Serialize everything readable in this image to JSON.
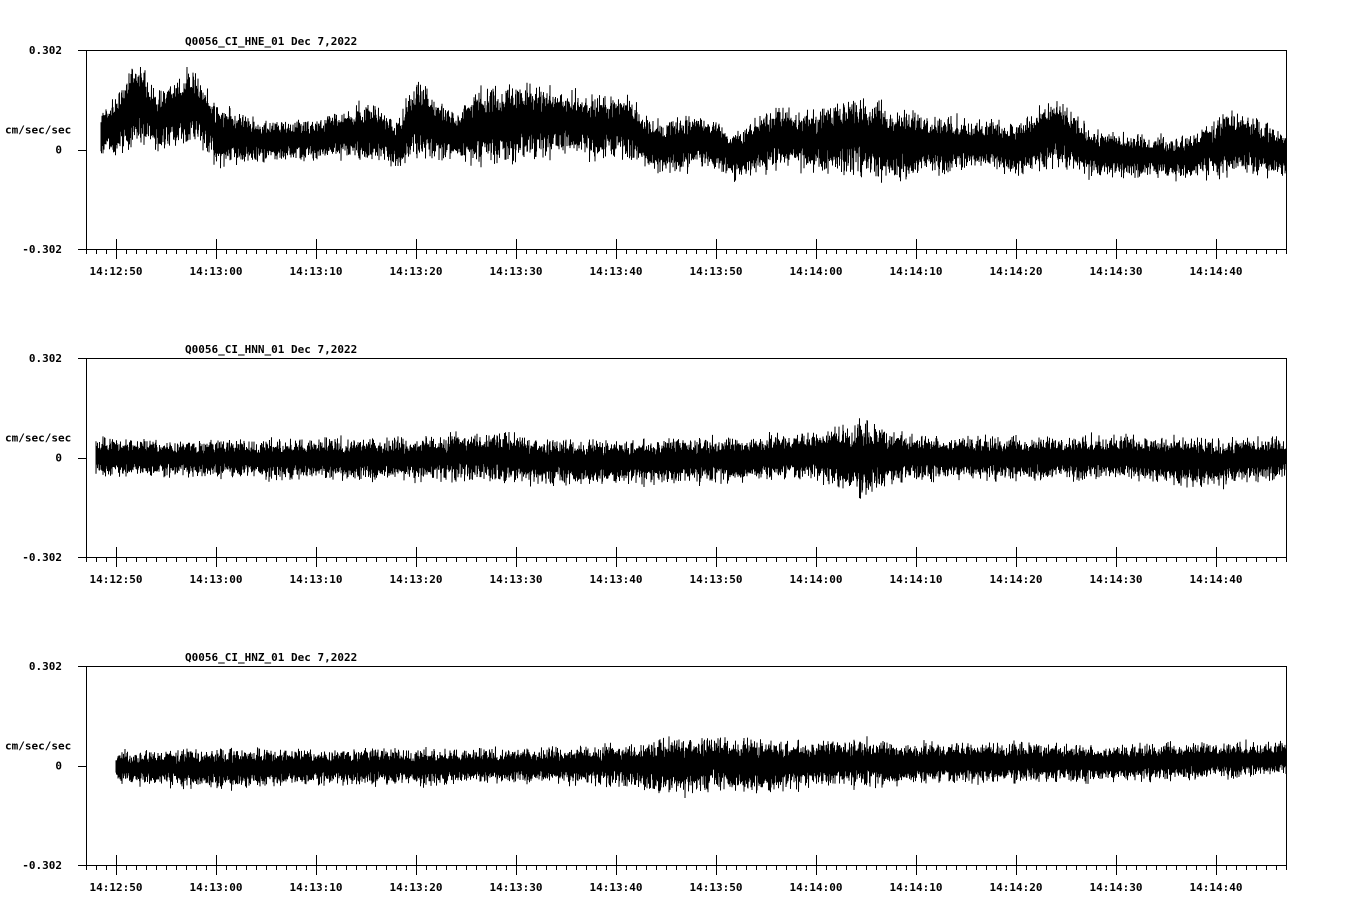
{
  "y_unit": "cm/sec/sec",
  "x_tick_labels": [
    "14:12:50",
    "14:13:00",
    "14:13:10",
    "14:13:20",
    "14:13:30",
    "14:13:40",
    "14:13:50",
    "14:14:00",
    "14:14:10",
    "14:14:20",
    "14:14:30",
    "14:14:40"
  ],
  "panels": [
    {
      "title": "Q0056_CI_HNE_01  Dec 7,2022",
      "ymax_label": "0.302",
      "zero_label": "0",
      "ymin_label": "-0.302"
    },
    {
      "title": "Q0056_CI_HNN_01  Dec 7,2022",
      "ymax_label": "0.302",
      "zero_label": "0",
      "ymin_label": "-0.302"
    },
    {
      "title": "Q0056_CI_HNZ_01  Dec 7,2022",
      "ymax_label": "0.302",
      "zero_label": "0",
      "ymin_label": "-0.302"
    }
  ],
  "chart_data": [
    {
      "type": "line",
      "title": "Q0056_CI_HNE_01  Dec 7,2022",
      "ylabel": "cm/sec/sec",
      "ylim": [
        -0.302,
        0.302
      ],
      "xlim": [
        "14:12:47",
        "14:14:47"
      ],
      "x_ticks": [
        "14:12:50",
        "14:13:00",
        "14:13:10",
        "14:13:20",
        "14:13:30",
        "14:13:40",
        "14:13:50",
        "14:14:00",
        "14:14:10",
        "14:14:20",
        "14:14:30",
        "14:14:40"
      ],
      "series_start": "14:12:48.5",
      "envelope": {
        "x": [
          "14:12:48.5",
          "14:12:50",
          "14:12:52",
          "14:12:54",
          "14:12:56",
          "14:12:58",
          "14:13:00",
          "14:13:05",
          "14:13:10",
          "14:13:14",
          "14:13:16",
          "14:13:18",
          "14:13:20",
          "14:13:24",
          "14:13:26",
          "14:13:30",
          "14:13:34",
          "14:13:38",
          "14:13:41",
          "14:13:44",
          "14:13:49",
          "14:13:52",
          "14:13:56",
          "14:14:00",
          "14:14:04",
          "14:14:07",
          "14:14:12",
          "14:14:17",
          "14:14:20",
          "14:14:24",
          "14:14:28",
          "14:14:33",
          "14:14:37",
          "14:14:42",
          "14:14:47"
        ],
        "max": [
          0.12,
          0.18,
          0.3,
          0.2,
          0.22,
          0.28,
          0.15,
          0.1,
          0.1,
          0.15,
          0.15,
          0.1,
          0.23,
          0.12,
          0.2,
          0.22,
          0.2,
          0.18,
          0.18,
          0.1,
          0.12,
          0.06,
          0.15,
          0.13,
          0.18,
          0.15,
          0.12,
          0.1,
          0.1,
          0.17,
          0.07,
          0.05,
          0.05,
          0.14,
          0.06
        ],
        "min": [
          -0.03,
          -0.03,
          -0.01,
          -0.02,
          0.0,
          0.0,
          -0.06,
          -0.05,
          -0.04,
          -0.04,
          -0.05,
          -0.07,
          -0.05,
          -0.04,
          -0.07,
          -0.05,
          -0.03,
          -0.04,
          -0.04,
          -0.09,
          -0.07,
          -0.1,
          -0.08,
          -0.08,
          -0.09,
          -0.12,
          -0.09,
          -0.07,
          -0.1,
          -0.06,
          -0.1,
          -0.09,
          -0.1,
          -0.09,
          -0.09
        ]
      }
    },
    {
      "type": "line",
      "title": "Q0056_CI_HNN_01  Dec 7,2022",
      "ylabel": "cm/sec/sec",
      "ylim": [
        -0.302,
        0.302
      ],
      "xlim": [
        "14:12:47",
        "14:14:47"
      ],
      "x_ticks": [
        "14:12:50",
        "14:13:00",
        "14:13:10",
        "14:13:20",
        "14:13:30",
        "14:13:40",
        "14:13:50",
        "14:14:00",
        "14:14:10",
        "14:14:20",
        "14:14:30",
        "14:14:40"
      ],
      "series_start": "14:12:48",
      "envelope": {
        "x": [
          "14:12:48",
          "14:13:00",
          "14:13:10",
          "14:13:20",
          "14:13:28",
          "14:13:32",
          "14:13:40",
          "14:13:50",
          "14:14:00",
          "14:14:03",
          "14:14:05",
          "14:14:07",
          "14:14:10",
          "14:14:20",
          "14:14:30",
          "14:14:40",
          "14:14:47"
        ],
        "max": [
          0.07,
          0.06,
          0.07,
          0.07,
          0.09,
          0.07,
          0.06,
          0.07,
          0.09,
          0.12,
          0.13,
          0.1,
          0.08,
          0.07,
          0.08,
          0.07,
          0.07
        ],
        "min": [
          -0.07,
          -0.07,
          -0.08,
          -0.08,
          -0.08,
          -0.09,
          -0.09,
          -0.09,
          -0.08,
          -0.12,
          -0.14,
          -0.1,
          -0.08,
          -0.08,
          -0.08,
          -0.1,
          -0.07
        ]
      }
    },
    {
      "type": "line",
      "title": "Q0056_CI_HNZ_01  Dec 7,2022",
      "ylabel": "cm/sec/sec",
      "ylim": [
        -0.302,
        0.302
      ],
      "xlim": [
        "14:12:47",
        "14:14:47"
      ],
      "x_ticks": [
        "14:12:50",
        "14:13:00",
        "14:13:10",
        "14:13:20",
        "14:13:30",
        "14:13:40",
        "14:13:50",
        "14:14:00",
        "14:14:10",
        "14:14:20",
        "14:14:30",
        "14:14:40"
      ],
      "series_start": "14:12:50",
      "envelope": {
        "x": [
          "14:12:50",
          "14:13:00",
          "14:13:10",
          "14:13:20",
          "14:13:30",
          "14:13:40",
          "14:13:47",
          "14:13:50",
          "14:13:55",
          "14:14:00",
          "14:14:05",
          "14:14:10",
          "14:14:20",
          "14:14:30",
          "14:14:40",
          "14:14:47"
        ],
        "max": [
          0.05,
          0.06,
          0.06,
          0.06,
          0.06,
          0.07,
          0.1,
          0.1,
          0.09,
          0.08,
          0.09,
          0.08,
          0.08,
          0.07,
          0.08,
          0.08
        ],
        "min": [
          -0.06,
          -0.08,
          -0.07,
          -0.07,
          -0.06,
          -0.07,
          -0.1,
          -0.08,
          -0.1,
          -0.07,
          -0.08,
          -0.07,
          -0.06,
          -0.06,
          -0.05,
          -0.04
        ]
      }
    }
  ]
}
